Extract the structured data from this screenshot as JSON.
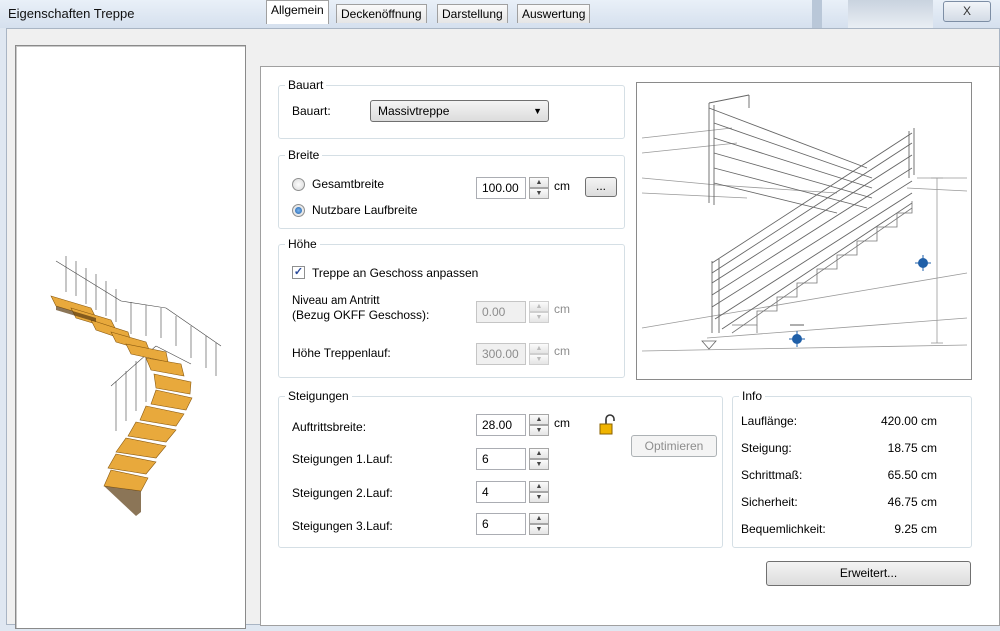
{
  "window": {
    "title": "Eigenschaften Treppe",
    "close_label": "X"
  },
  "tabs": [
    {
      "label": "Allgemein",
      "active": true
    },
    {
      "label": "Deckenöffnung",
      "active": false
    },
    {
      "label": "Darstellung",
      "active": false
    },
    {
      "label": "Auswertung",
      "active": false
    }
  ],
  "bauart": {
    "group_label": "Bauart",
    "label": "Bauart:",
    "selected": "Massivtreppe"
  },
  "breite": {
    "group_label": "Breite",
    "radio_gesamt": "Gesamtbreite",
    "radio_nutzbar": "Nutzbare Laufbreite",
    "selected": "Nutzbare Laufbreite",
    "value": "100.00",
    "unit": "cm",
    "more_label": "..."
  },
  "hoehe": {
    "group_label": "Höhe",
    "checkbox_label": "Treppe an Geschoss anpassen",
    "checked": true,
    "niveau_label_1": "Niveau am Antritt",
    "niveau_label_2": "(Bezug OKFF Geschoss):",
    "niveau_value": "0.00",
    "niveau_unit": "cm",
    "lauf_label": "Höhe Treppenlauf:",
    "lauf_value": "300.00",
    "lauf_unit": "cm"
  },
  "steigungen": {
    "group_label": "Steigungen",
    "auftritt_label": "Auftrittsbreite:",
    "auftritt_value": "28.00",
    "auftritt_unit": "cm",
    "lauf1_label": "Steigungen 1.Lauf:",
    "lauf1_value": "6",
    "lauf2_label": "Steigungen 2.Lauf:",
    "lauf2_value": "4",
    "lauf3_label": "Steigungen 3.Lauf:",
    "lauf3_value": "6",
    "optimieren_label": "Optimieren"
  },
  "info": {
    "group_label": "Info",
    "rows": [
      {
        "label": "Lauflänge:",
        "value": "420.00 cm"
      },
      {
        "label": "Steigung:",
        "value": "18.75 cm"
      },
      {
        "label": "Schrittmaß:",
        "value": "65.50 cm"
      },
      {
        "label": "Sicherheit:",
        "value": "46.75 cm"
      },
      {
        "label": "Bequemlichkeit:",
        "value": "9.25 cm"
      }
    ]
  },
  "erweitert_label": "Erweitert...",
  "colors": {
    "step_wood": "#e8a93c",
    "handle_blue": "#1f5fa8",
    "lock_yellow": "#f0b400"
  }
}
